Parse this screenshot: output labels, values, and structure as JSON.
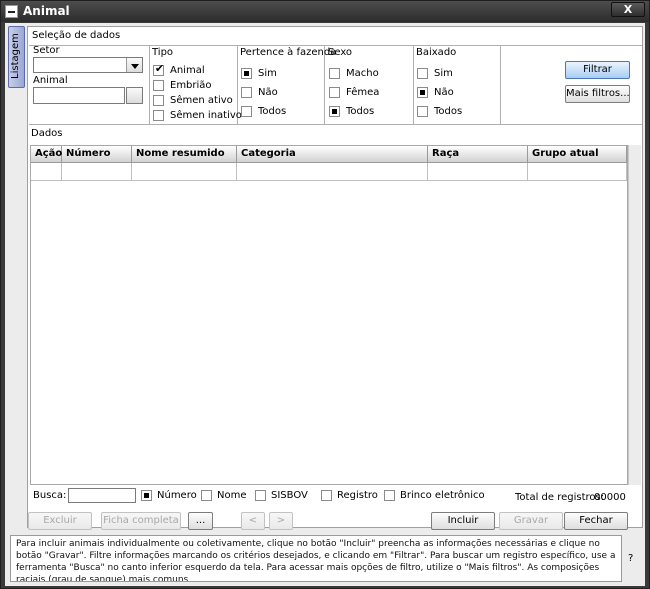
{
  "window": {
    "title": "Animal",
    "close_label": "X"
  },
  "side_tab": {
    "label": "Listagem"
  },
  "selection": {
    "heading": "Seleção de dados",
    "setor_label": "Setor",
    "setor_value": "",
    "animal_label": "Animal",
    "animal_value": ""
  },
  "tipo": {
    "title": "Tipo",
    "options": [
      {
        "label": "Animal",
        "checked": true
      },
      {
        "label": "Embrião",
        "checked": false
      },
      {
        "label": "Sêmen ativo",
        "checked": false
      },
      {
        "label": "Sêmen inativo",
        "checked": false
      }
    ]
  },
  "pertence": {
    "title": "Pertence à fazenda",
    "options": [
      {
        "label": "Sim",
        "selected": true
      },
      {
        "label": "Não",
        "selected": false
      },
      {
        "label": "Todos",
        "selected": false
      }
    ]
  },
  "sexo": {
    "title": "Sexo",
    "options": [
      {
        "label": "Macho",
        "selected": false
      },
      {
        "label": "Fêmea",
        "selected": false
      },
      {
        "label": "Todos",
        "selected": true
      }
    ]
  },
  "baixado": {
    "title": "Baixado",
    "options": [
      {
        "label": "Sim",
        "selected": false
      },
      {
        "label": "Não",
        "selected": true
      },
      {
        "label": "Todos",
        "selected": false
      }
    ]
  },
  "actions": {
    "filtrar": "Filtrar",
    "mais_filtros": "Mais filtros..."
  },
  "dados": {
    "heading": "Dados",
    "columns": [
      "Ação",
      "Número",
      "Nome resumido",
      "Categoria",
      "Raça",
      "Grupo atual"
    ]
  },
  "search": {
    "label": "Busca:",
    "value": "",
    "options": [
      {
        "label": "Número",
        "selected": true
      },
      {
        "label": "Nome",
        "selected": false
      },
      {
        "label": "SISBOV",
        "selected": false
      },
      {
        "label": "Registro",
        "selected": false
      },
      {
        "label": "Brinco eletrônico",
        "selected": false
      }
    ],
    "total_label": "Total de registros:",
    "total_value": "00000"
  },
  "buttons": {
    "excluir": "Excluir",
    "ficha": "Ficha completa",
    "ellipsis": "...",
    "prev": "<",
    "next": ">",
    "incluir": "Incluir",
    "gravar": "Gravar",
    "fechar": "Fechar"
  },
  "info": {
    "text": "Para incluir animais individualmente ou coletivamente, clique no botão \"Incluir\" preencha as informações necessárias e clique no botão \"Gravar\". Filtre informações marcando os critérios desejados, e clicando em \"Filtrar\". Para buscar um registro específico, use a ferramenta \"Busca\" no canto inferior esquerdo da tela. Para acessar mais opções de filtro, utilize o \"Mais filtros\". As composições raciais (grau de sangue) mais comuns",
    "help": "?"
  }
}
